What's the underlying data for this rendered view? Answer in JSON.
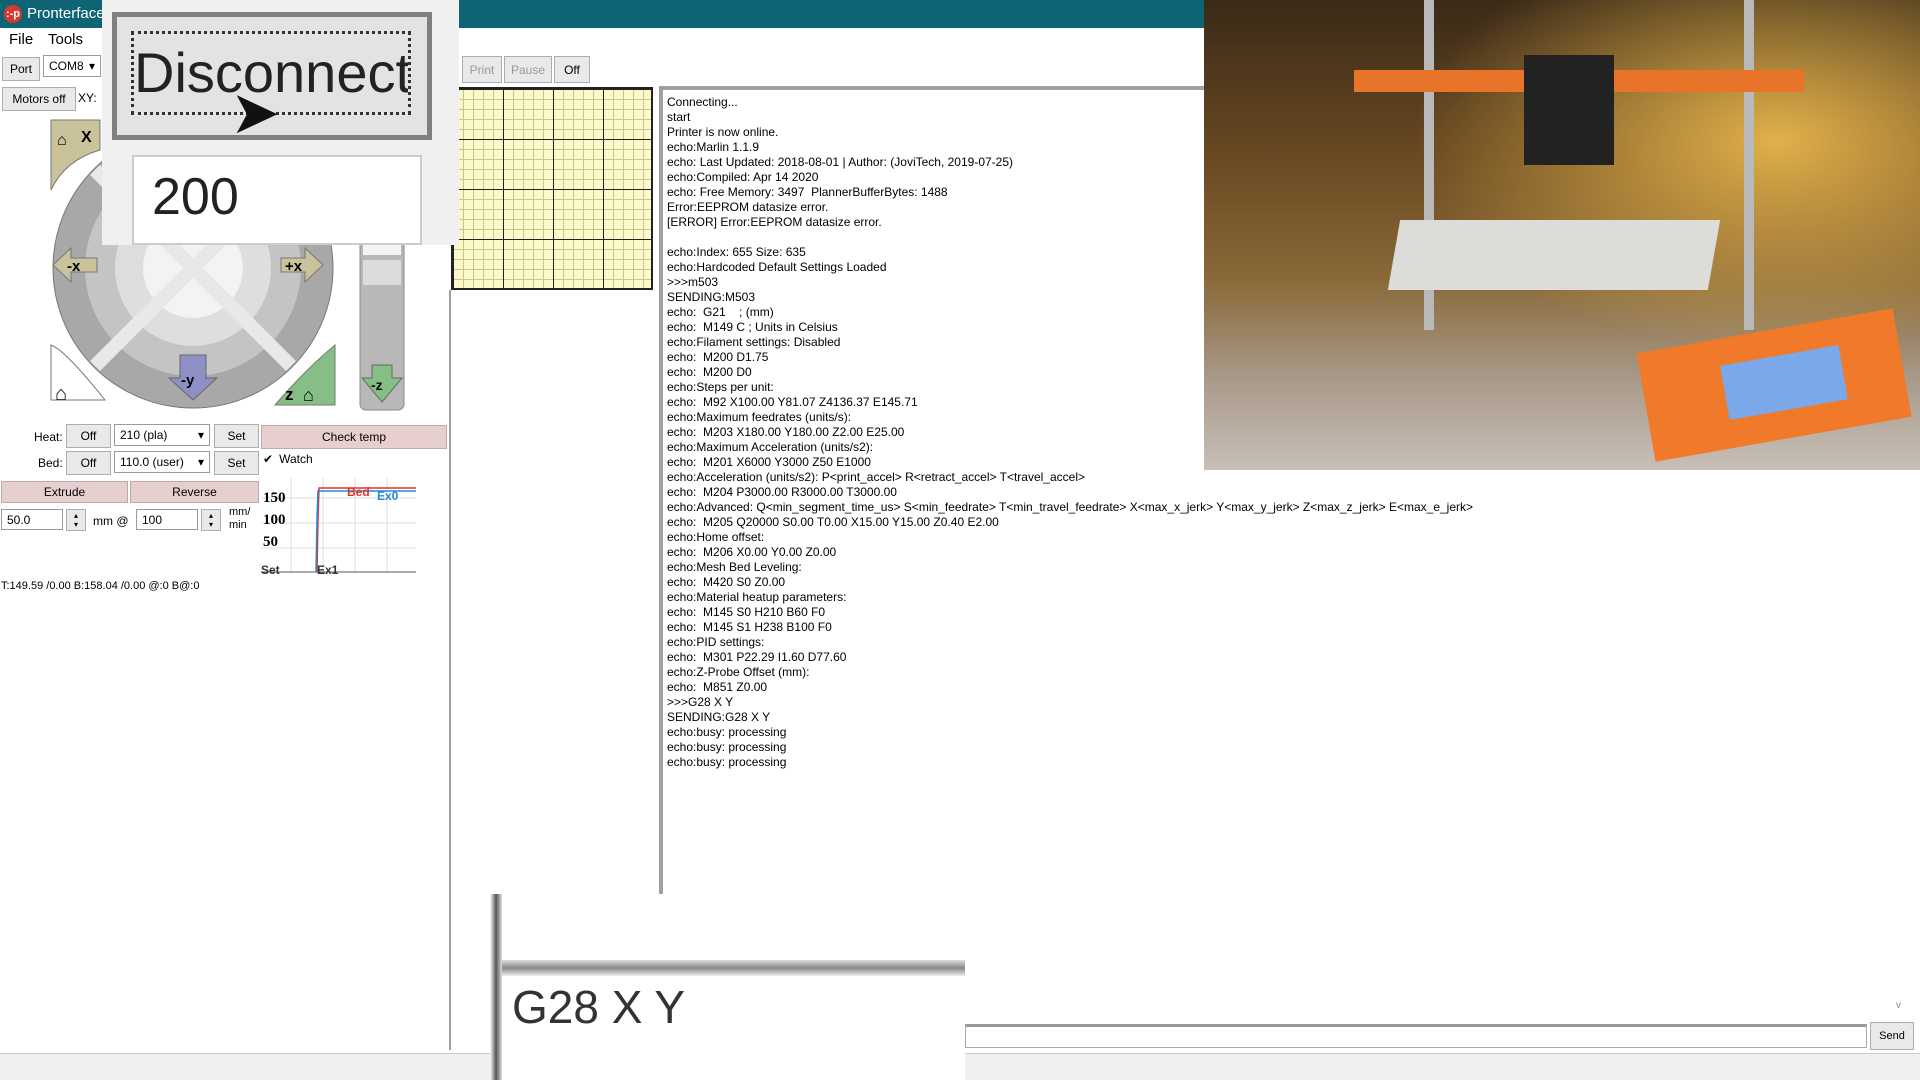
{
  "app": {
    "title": "Pronterface",
    "logo": ":-p"
  },
  "menu": [
    "File",
    "Tools"
  ],
  "toolbar": {
    "port_label": "Port",
    "port_value": "COM8",
    "motors_off": "Motors off",
    "xy_label": "XY:",
    "print": "Print",
    "pause": "Pause",
    "off": "Off"
  },
  "zoom_overlay_top": {
    "button_label": "Disconnect",
    "field_value": "200"
  },
  "zoom_overlay_bottom": {
    "command_value": "G28 X Y"
  },
  "jog": {
    "home_x": "X",
    "minus_x": "-x",
    "plus_x": "+x",
    "minus_y": "-y",
    "home_z": "z",
    "minus_z": "-z"
  },
  "temps": {
    "heat_label": "Heat:",
    "heat_off": "Off",
    "heat_value": "210 (pla)",
    "heat_set": "Set",
    "bed_label": "Bed:",
    "bed_off": "Off",
    "bed_value": "110.0 (user)",
    "bed_set": "Set",
    "check_temp": "Check temp",
    "watch_label": "Watch",
    "watch_checked": true
  },
  "extrude": {
    "extrude": "Extrude",
    "reverse": "Reverse",
    "length": "50.0",
    "mm_at": "mm @",
    "speed": "100",
    "unit_top": "mm/",
    "unit_bottom": "min"
  },
  "temp_graph": {
    "y_ticks": [
      "150",
      "100",
      "50"
    ],
    "labels": {
      "bed": "Bed",
      "ex0": "Ex0",
      "ex1": "Ex1",
      "set": "Set"
    },
    "colors": {
      "bed": "#e0332b",
      "ex0": "#2a8ad8"
    }
  },
  "status_line": "T:149.59 /0.00 B:158.04 /0.00 @:0 B@:0",
  "log": [
    "Connecting...",
    "start",
    "Printer is now online.",
    "echo:Marlin 1.1.9",
    "echo: Last Updated: 2018-08-01 | Author: (JoviTech, 2019-07-25)",
    "echo:Compiled: Apr 14 2020",
    "echo: Free Memory: 3497  PlannerBufferBytes: 1488",
    "Error:EEPROM datasize error.",
    "[ERROR] Error:EEPROM datasize error.",
    "",
    "echo:Index: 655 Size: 635",
    "echo:Hardcoded Default Settings Loaded",
    ">>>m503",
    "SENDING:M503",
    "echo:  G21    ; (mm)",
    "echo:  M149 C ; Units in Celsius",
    "echo:Filament settings: Disabled",
    "echo:  M200 D1.75",
    "echo:  M200 D0",
    "echo:Steps per unit:",
    "echo:  M92 X100.00 Y81.07 Z4136.37 E145.71",
    "echo:Maximum feedrates (units/s):",
    "echo:  M203 X180.00 Y180.00 Z2.00 E25.00",
    "echo:Maximum Acceleration (units/s2):",
    "echo:  M201 X6000 Y3000 Z50 E1000",
    "echo:Acceleration (units/s2): P<print_accel> R<retract_accel> T<travel_accel>",
    "echo:  M204 P3000.00 R3000.00 T3000.00",
    "echo:Advanced: Q<min_segment_time_us> S<min_feedrate> T<min_travel_feedrate> X<max_x_jerk> Y<max_y_jerk> Z<max_z_jerk> E<max_e_jerk>",
    "echo:  M205 Q20000 S0.00 T0.00 X15.00 Y15.00 Z0.40 E2.00",
    "echo:Home offset:",
    "echo:  M206 X0.00 Y0.00 Z0.00",
    "echo:Mesh Bed Leveling:",
    "echo:  M420 S0 Z0.00",
    "echo:Material heatup parameters:",
    "echo:  M145 S0 H210 B60 F0",
    "echo:  M145 S1 H238 B100 F0",
    "echo:PID settings:",
    "echo:  M301 P22.29 I1.60 D77.60",
    "echo:Z-Probe Offset (mm):",
    "echo:  M851 Z0.00",
    ">>>G28 X Y",
    "SENDING:G28 X Y",
    "echo:busy: processing",
    "echo:busy: processing",
    "echo:busy: processing"
  ],
  "command": {
    "value": "",
    "send": "Send"
  }
}
